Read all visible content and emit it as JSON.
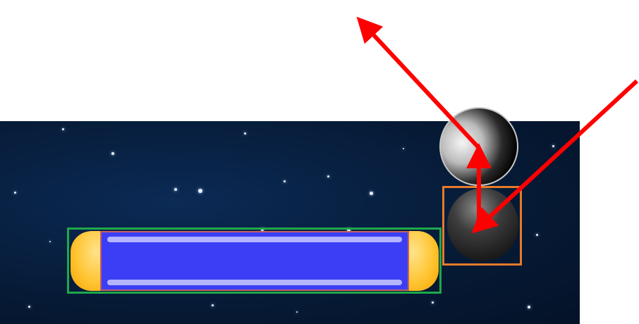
{
  "scene": {
    "background": "starfield",
    "paddle": {
      "colors": {
        "body": "#3b3ef5",
        "caps": "#ffc533",
        "rails": "#b4b4ff"
      },
      "highlight_color": "#1fa84a"
    },
    "ball": {
      "color": "#1b1b1b",
      "highlight_color": "#e67a2b"
    },
    "predicted_ball": {
      "color": "#000000"
    },
    "arrows": {
      "color": "#ff0000",
      "items": [
        {
          "name": "incoming-trajectory"
        },
        {
          "name": "bounce-up-vector"
        },
        {
          "name": "outgoing-trajectory"
        }
      ]
    }
  }
}
